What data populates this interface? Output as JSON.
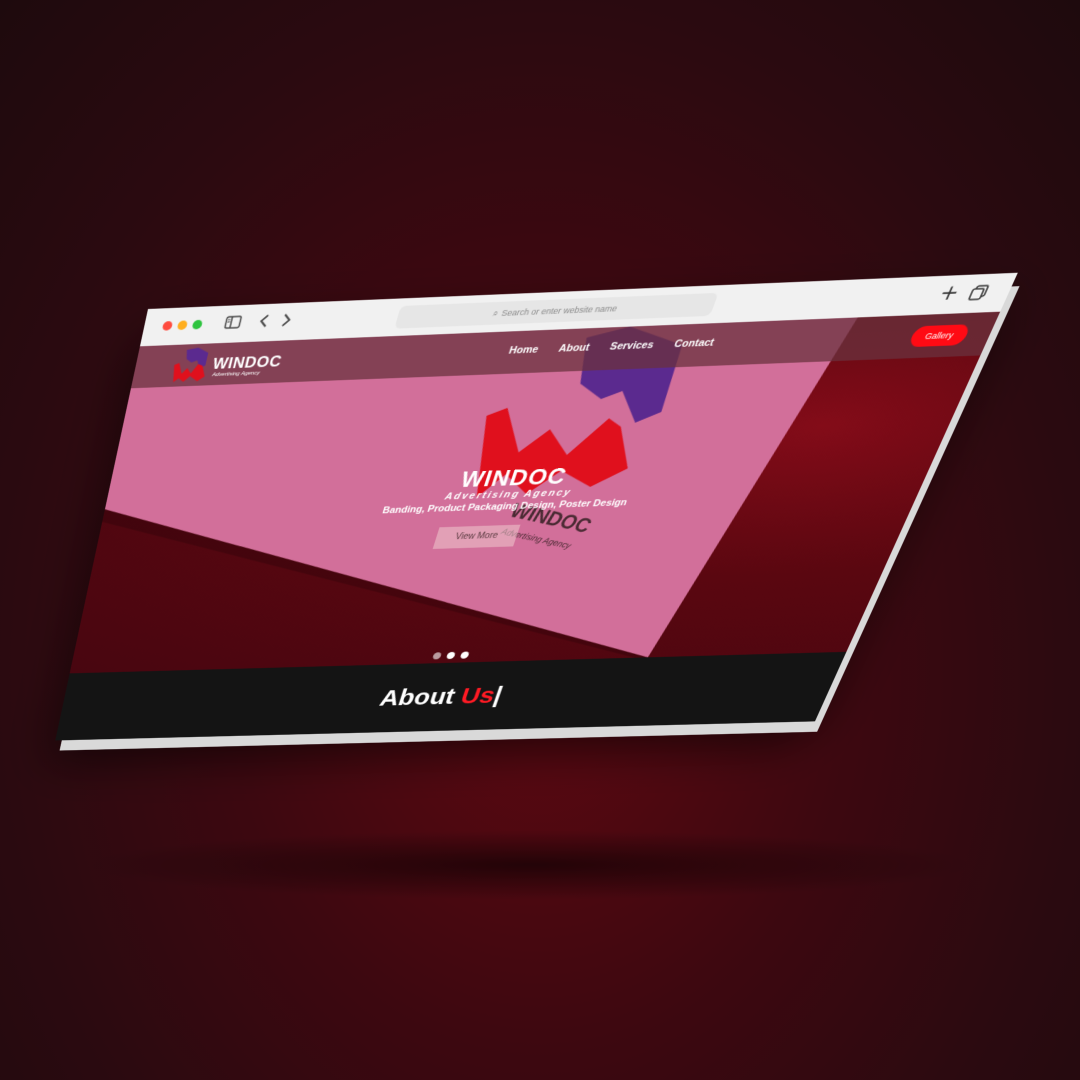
{
  "browser": {
    "address_placeholder": "Search or enter website name"
  },
  "header": {
    "brand_name": "WINDOC",
    "brand_tagline": "Advertising Agency",
    "nav": [
      "Home",
      "About",
      "Services",
      "Contact"
    ],
    "cta_label": "Gallery"
  },
  "hero": {
    "title": "WINDOC",
    "subtitle": "Advertising Agency",
    "services": "Banding, Product Packaging Design, Poster Design",
    "button_label": "View More",
    "paper_brand_name": "WINDOC",
    "paper_brand_tagline": "Advertising Agency",
    "slides_total": 3,
    "active_slide": 2
  },
  "about": {
    "title_part1": "About ",
    "title_part2": "Us",
    "caret": "|"
  },
  "colors": {
    "accent_red": "#ff0a14",
    "logo_purple": "#5b2a8f",
    "logo_red": "#e0101d",
    "paper_pink": "#d26f9a",
    "hero_dark_red": "#5a0710",
    "about_bg": "#141414",
    "chrome_bg": "#f1f1f1"
  },
  "icons": [
    "search-icon",
    "sidebar-toggle-icon",
    "back-arrow-icon",
    "forward-arrow-icon",
    "new-tab-plus-icon",
    "tabs-overview-icon",
    "windoc-logo-icon"
  ]
}
